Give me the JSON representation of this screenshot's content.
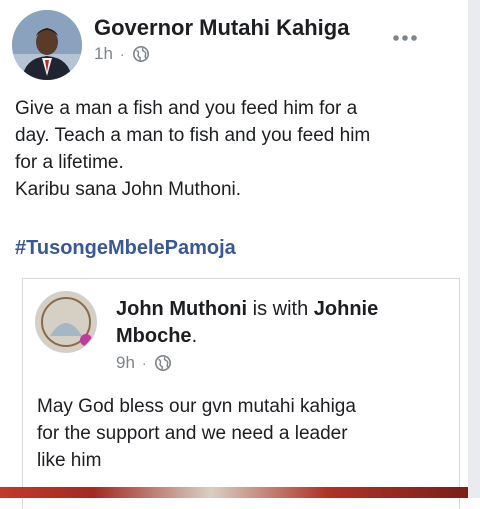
{
  "post": {
    "author": "Governor Mutahi Kahiga",
    "time": "1h",
    "separator": "·",
    "privacy_icon": "globe-icon",
    "more_icon": "more-options-icon",
    "text_lines": [
      "Give a man a fish and you feed him for a",
      "day. Teach a man to fish and you feed him",
      "for a lifetime.",
      "Karibu sana John Muthoni."
    ],
    "hashtag": "#TusongeMbelePamoja"
  },
  "shared": {
    "author": "John Muthoni",
    "with_text": " is with ",
    "tagged": "Johnie Mboche",
    "period": ".",
    "time": "9h",
    "separator": "·",
    "privacy_icon": "globe-icon",
    "text_lines": [
      "May God bless our gvn mutahi kahiga",
      "for the support and we need a leader",
      "like him"
    ]
  },
  "colors": {
    "link": "#385898",
    "meta": "#7f858c",
    "text": "#1c1e21"
  }
}
